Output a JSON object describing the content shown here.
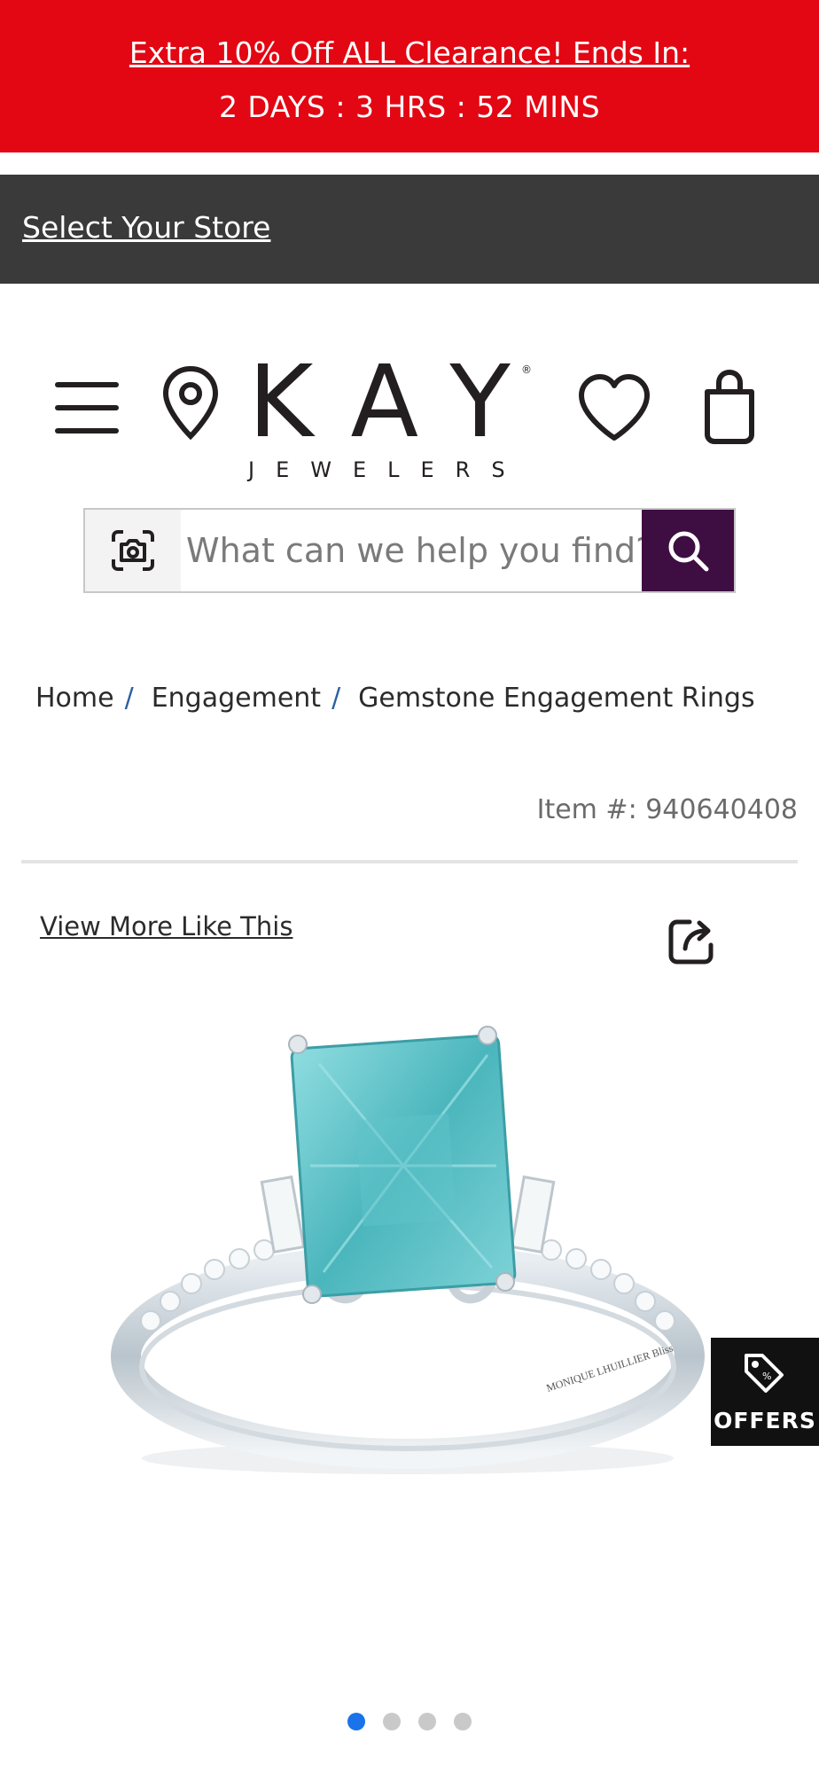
{
  "promo": {
    "headline": "Extra 10% Off ALL Clearance! Ends In: ",
    "countdown": "2 DAYS : 3  HRS : 52 MINS",
    "background_color": "#e30613"
  },
  "store_bar": {
    "label": "Select Your Store"
  },
  "header": {
    "logo_main": "KAY",
    "logo_sub": "JEWELERS",
    "logo_reg": "®",
    "icons": [
      "menu-icon",
      "location-pin-icon",
      "heart-icon",
      "shopping-bag-icon"
    ]
  },
  "search": {
    "placeholder": "What can we help you find?",
    "camera_icon": "camera-scan-icon",
    "submit_icon": "search-icon",
    "button_color": "#3e0d42"
  },
  "breadcrumb": {
    "items": [
      "Home",
      "Engagement",
      "Gemstone Engagement Rings"
    ],
    "separator": "/"
  },
  "product": {
    "item_number": "Item #: 940640408",
    "view_more": "View More Like This",
    "share_icon": "share-icon",
    "engraving": "MONIQUE LHUILLIER Bliss"
  },
  "offers": {
    "label": "OFFERS",
    "icon": "price-tag-icon"
  },
  "carousel": {
    "count": 4,
    "active_index": 0
  }
}
